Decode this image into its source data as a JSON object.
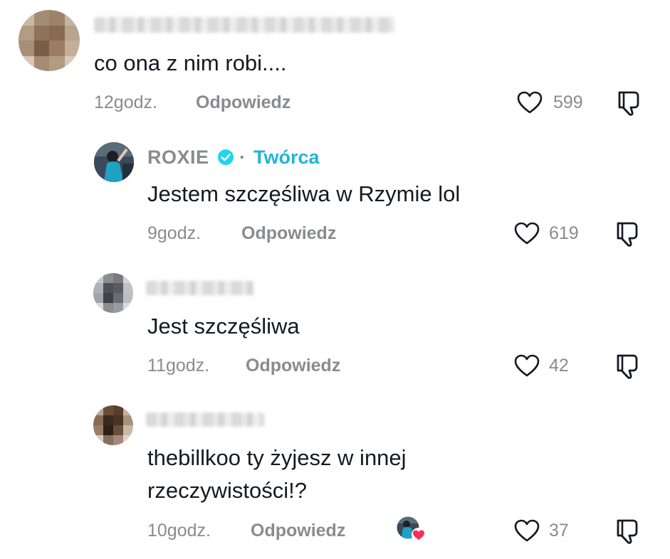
{
  "comments": [
    {
      "text": "co ona z nim robi....",
      "time": "12godz.",
      "reply_label": "Odpowiedz",
      "likes": "599"
    },
    {
      "author": "ROXIE",
      "author_tag": "Twórca",
      "separator": "·",
      "text": "Jestem szczęśliwa w Rzymie lol",
      "time": "9godz.",
      "reply_label": "Odpowiedz",
      "likes": "619"
    },
    {
      "text": "Jest szczęśliwa",
      "time": "11godz.",
      "reply_label": "Odpowiedz",
      "likes": "42"
    },
    {
      "text_line1": "thebillkoo ty żyjesz w innej",
      "text_line2": "rzeczywistości!?",
      "time": "10godz.",
      "reply_label": "Odpowiedz",
      "likes": "37"
    }
  ],
  "colors": {
    "text": "#161823",
    "secondary": "#8a8b91",
    "creator_tag": "#22b4d6",
    "verified": "#20d5ec",
    "heart": "#fe2c55"
  },
  "icons": {
    "like": "heart-outline-icon",
    "dislike": "thumbs-down-icon",
    "verified": "verified-badge-icon",
    "creator_liked": "creator-liked-heart-icon"
  }
}
